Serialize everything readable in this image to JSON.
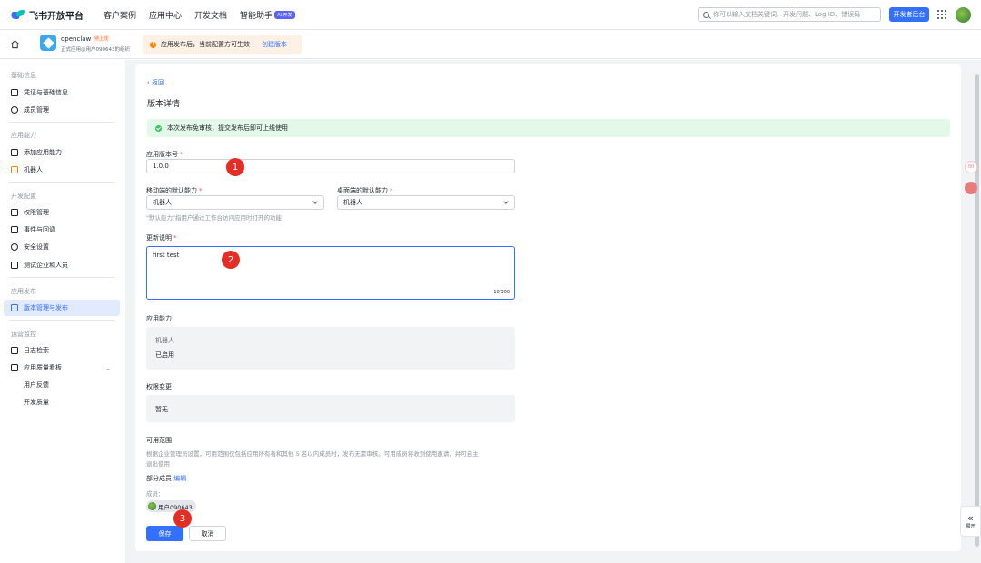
{
  "topnav": {
    "brand": "飞书开放平台",
    "items": [
      "客户案例",
      "应用中心",
      "开发文档",
      "智能助手"
    ],
    "ai_badge": "AI 开发",
    "search_placeholder": "你可以输入文档关键词、开发问题、Log ID、错误码",
    "dev_console": "开发者后台"
  },
  "subbar": {
    "app_name": "openclaw",
    "online_badge": "待上线",
    "app_sub": "正式应用@用户090643的组织",
    "notice": "应用发布后，当前配置方可生效",
    "notice_link": "创建版本"
  },
  "sidebar": {
    "sections": [
      {
        "title": "基础信息",
        "items": [
          "凭证与基础信息",
          "成员管理"
        ]
      },
      {
        "title": "应用能力",
        "items": [
          "添加应用能力",
          "机器人"
        ]
      },
      {
        "title": "开发配置",
        "items": [
          "权限管理",
          "事件与回调",
          "安全设置",
          "测试企业和人员"
        ]
      },
      {
        "title": "应用发布",
        "items": [
          "版本管理与发布"
        ]
      },
      {
        "title": "运营监控",
        "items": [
          "日志检索",
          "应用质量看板",
          "用户反馈",
          "开发质量"
        ]
      }
    ]
  },
  "main": {
    "back": "返回",
    "title": "版本详情",
    "success": "本次发布免审核，提交发布后即可上线使用",
    "version_label": "应用版本号",
    "version_value": "1.0.0",
    "mobile_label": "移动端的默认能力",
    "mobile_value": "机器人",
    "desktop_label": "桌面端的默认能力",
    "desktop_value": "机器人",
    "default_hint": "\"默认能力\"指用户通过工作台访问应用时打开的功能",
    "notes_label": "更新说明",
    "notes_value": "first test",
    "notes_counter": "10/300",
    "capability_label": "应用能力",
    "capability_name": "机器人",
    "capability_status": "已启用",
    "perm_label": "权限变更",
    "perm_value": "暂无",
    "scope_label": "可用范围",
    "scope_desc_1": "根据企业管理员设置，可用范围仅包括应用所有者和其他 5 名以内成员时，发布无需审核。可用成员将收到使用邀请，并可自主",
    "scope_desc_2": "退出使用",
    "scope_part": "部分成员",
    "scope_edit": "编辑",
    "members_label": "成员：",
    "member_name": "用户090643",
    "save": "保存",
    "cancel": "取消"
  },
  "markers": [
    "1",
    "2",
    "3"
  ],
  "expand": "展开"
}
